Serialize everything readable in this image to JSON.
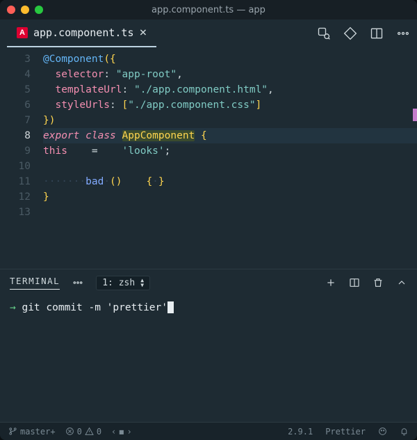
{
  "titlebar": {
    "title": "app.component.ts — app"
  },
  "tab": {
    "filename": "app.component.ts"
  },
  "editor": {
    "active_line": 8,
    "lines": [
      {
        "num": 3,
        "seg": [
          [
            "dec",
            "@Component"
          ],
          [
            "br",
            "("
          ],
          [
            "br",
            "{"
          ]
        ]
      },
      {
        "num": 4,
        "seg": [
          [
            "pn",
            "  "
          ],
          [
            "key",
            "selector"
          ],
          [
            "pn",
            ": "
          ],
          [
            "str",
            "\"app-root\""
          ],
          [
            "pn",
            ","
          ]
        ]
      },
      {
        "num": 5,
        "seg": [
          [
            "pn",
            "  "
          ],
          [
            "key",
            "templateUrl"
          ],
          [
            "pn",
            ": "
          ],
          [
            "str",
            "\"./app.component.html\""
          ],
          [
            "pn",
            ","
          ]
        ]
      },
      {
        "num": 6,
        "seg": [
          [
            "pn",
            "  "
          ],
          [
            "key",
            "styleUrls"
          ],
          [
            "pn",
            ": "
          ],
          [
            "br",
            "["
          ],
          [
            "str",
            "\"./app.component.css\""
          ],
          [
            "br",
            "]"
          ]
        ]
      },
      {
        "num": 7,
        "seg": [
          [
            "br",
            "}"
          ],
          [
            "br",
            ")"
          ]
        ]
      },
      {
        "num": 8,
        "seg": [
          [
            "k",
            "export"
          ],
          [
            "pn",
            " "
          ],
          [
            "k",
            "class"
          ],
          [
            "pn",
            " "
          ],
          [
            "cls",
            "AppComponent"
          ],
          [
            "pn",
            " "
          ],
          [
            "br",
            "{"
          ]
        ]
      },
      {
        "num": 9,
        "seg": [
          [
            "key",
            "this"
          ],
          [
            "pn",
            "    "
          ],
          [
            "pn",
            "="
          ],
          [
            "pn",
            "    "
          ],
          [
            "str",
            "'looks'"
          ],
          [
            "pn",
            ";"
          ]
        ]
      },
      {
        "num": 10,
        "seg": []
      },
      {
        "num": 11,
        "seg": [
          [
            "ws",
            "·······"
          ],
          [
            "fn",
            "bad"
          ],
          [
            "ws",
            "·"
          ],
          [
            "br",
            "()"
          ],
          [
            "pn",
            "    "
          ],
          [
            "br",
            "{"
          ],
          [
            "ws",
            "·"
          ],
          [
            "br",
            "}"
          ]
        ]
      },
      {
        "num": 12,
        "seg": [
          [
            "br",
            "}"
          ]
        ]
      },
      {
        "num": 13,
        "seg": []
      }
    ]
  },
  "terminal": {
    "tab_label": "TERMINAL",
    "selector": "1: zsh",
    "prompt_arrow": "→",
    "command": "git commit -m 'prettier'"
  },
  "status": {
    "branch": "master+",
    "errors": "0",
    "warnings": "0",
    "nav_prev": "‹",
    "nav_stop": "◼",
    "nav_next": "›",
    "prettier_version": "2.9.1",
    "prettier_label": "Prettier"
  }
}
